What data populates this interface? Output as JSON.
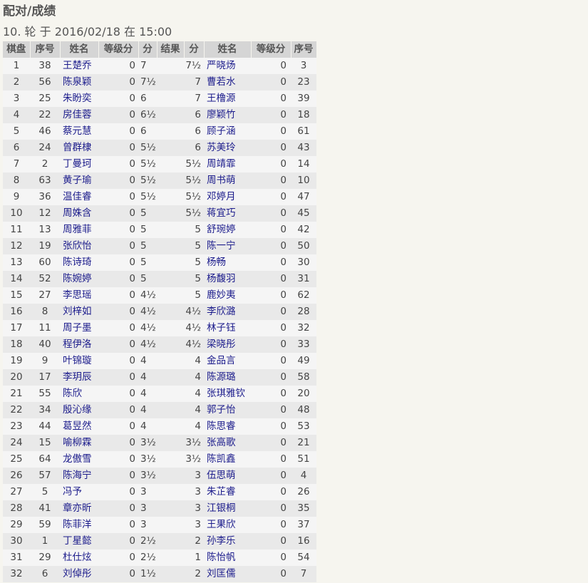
{
  "page": {
    "title": "配对/成绩",
    "subtitle": "10. 轮 于 2016/02/18 在 15:00"
  },
  "table": {
    "headers": [
      "棋盘",
      "序号",
      "姓名",
      "等级分",
      "分",
      "结果",
      "分",
      "姓名",
      "等级分",
      "序号"
    ],
    "rows": [
      [
        "1",
        "38",
        "王楚乔",
        "0",
        "7",
        "",
        "7½",
        "严晓炀",
        "0",
        "3"
      ],
      [
        "2",
        "56",
        "陈泉颖",
        "0",
        "7½",
        "",
        "7",
        "曹若水",
        "0",
        "23"
      ],
      [
        "3",
        "25",
        "朱盼奕",
        "0",
        "6",
        "",
        "7",
        "王橹源",
        "0",
        "39"
      ],
      [
        "4",
        "22",
        "房佳蓉",
        "0",
        "6½",
        "",
        "6",
        "廖颖竹",
        "0",
        "18"
      ],
      [
        "5",
        "46",
        "蔡元慧",
        "0",
        "6",
        "",
        "6",
        "顾子涵",
        "0",
        "61"
      ],
      [
        "6",
        "24",
        "曾群棣",
        "0",
        "5½",
        "",
        "6",
        "苏美玲",
        "0",
        "43"
      ],
      [
        "7",
        "2",
        "丁曼珂",
        "0",
        "5½",
        "",
        "5½",
        "周靖霏",
        "0",
        "14"
      ],
      [
        "8",
        "63",
        "黄子瑜",
        "0",
        "5½",
        "",
        "5½",
        "周书萌",
        "0",
        "10"
      ],
      [
        "9",
        "36",
        "温佳睿",
        "0",
        "5½",
        "",
        "5½",
        "邓婷月",
        "0",
        "47"
      ],
      [
        "10",
        "12",
        "周姝含",
        "0",
        "5",
        "",
        "5½",
        "蒋宜巧",
        "0",
        "45"
      ],
      [
        "11",
        "13",
        "周雅菲",
        "0",
        "5",
        "",
        "5",
        "舒琬婷",
        "0",
        "42"
      ],
      [
        "12",
        "19",
        "张欣怡",
        "0",
        "5",
        "",
        "5",
        "陈一宁",
        "0",
        "50"
      ],
      [
        "13",
        "60",
        "陈诗琦",
        "0",
        "5",
        "",
        "5",
        "杨畅",
        "0",
        "30"
      ],
      [
        "14",
        "52",
        "陈婉婷",
        "0",
        "5",
        "",
        "5",
        "杨馥羽",
        "0",
        "31"
      ],
      [
        "15",
        "27",
        "李思瑶",
        "0",
        "4½",
        "",
        "5",
        "鹿妙夷",
        "0",
        "62"
      ],
      [
        "16",
        "8",
        "刘梓如",
        "0",
        "4½",
        "",
        "4½",
        "李欣潞",
        "0",
        "28"
      ],
      [
        "17",
        "11",
        "周子墨",
        "0",
        "4½",
        "",
        "4½",
        "林子钰",
        "0",
        "32"
      ],
      [
        "18",
        "40",
        "程伊洛",
        "0",
        "4½",
        "",
        "4½",
        "梁晓彤",
        "0",
        "33"
      ],
      [
        "19",
        "9",
        "叶锦璇",
        "0",
        "4",
        "",
        "4",
        "金品言",
        "0",
        "49"
      ],
      [
        "20",
        "17",
        "李玥辰",
        "0",
        "4",
        "",
        "4",
        "陈源璐",
        "0",
        "58"
      ],
      [
        "21",
        "55",
        "陈欣",
        "0",
        "4",
        "",
        "4",
        "张琪雅钦",
        "0",
        "20"
      ],
      [
        "22",
        "34",
        "殷沁缘",
        "0",
        "4",
        "",
        "4",
        "郭子怡",
        "0",
        "48"
      ],
      [
        "23",
        "44",
        "葛昱然",
        "0",
        "4",
        "",
        "4",
        "陈思睿",
        "0",
        "53"
      ],
      [
        "24",
        "15",
        "喻柳霖",
        "0",
        "3½",
        "",
        "3½",
        "张高歌",
        "0",
        "21"
      ],
      [
        "25",
        "64",
        "龙傲雪",
        "0",
        "3½",
        "",
        "3½",
        "陈凯鑫",
        "0",
        "51"
      ],
      [
        "26",
        "57",
        "陈海宁",
        "0",
        "3½",
        "",
        "3",
        "伍思萌",
        "0",
        "4"
      ],
      [
        "27",
        "5",
        "冯予",
        "0",
        "3",
        "",
        "3",
        "朱芷睿",
        "0",
        "26"
      ],
      [
        "28",
        "41",
        "章亦昕",
        "0",
        "3",
        "",
        "3",
        "江银桐",
        "0",
        "35"
      ],
      [
        "29",
        "59",
        "陈菲洋",
        "0",
        "3",
        "",
        "3",
        "王果欣",
        "0",
        "37"
      ],
      [
        "30",
        "1",
        "丁星懿",
        "0",
        "2½",
        "",
        "2",
        "孙李乐",
        "0",
        "16"
      ],
      [
        "31",
        "29",
        "杜仕炫",
        "0",
        "2½",
        "",
        "1",
        "陈怡帆",
        "0",
        "54"
      ],
      [
        "32",
        "6",
        "刘倬彤",
        "0",
        "1½",
        "",
        "2",
        "刘匡儒",
        "0",
        "7"
      ]
    ]
  },
  "colors": {
    "background": "#f6f5ef",
    "header_bg": "#d5d5d5",
    "row_light": "#f5f5f5",
    "row_dark": "#e9e9e9",
    "name_link": "#1c1c8c"
  }
}
